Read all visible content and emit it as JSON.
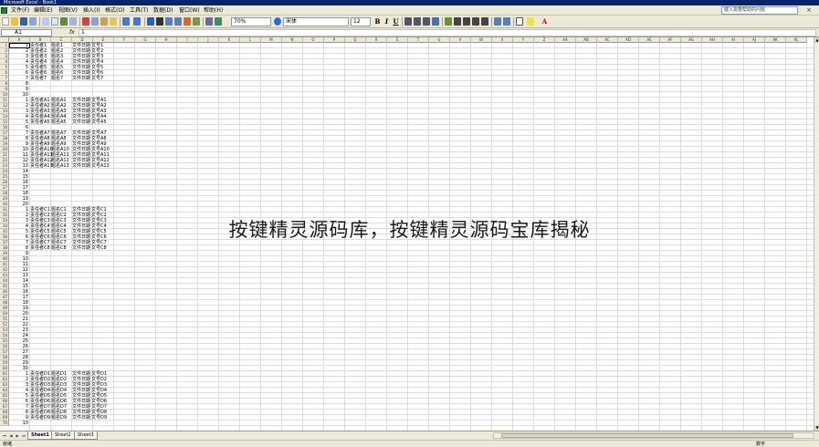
{
  "window": {
    "title": "Microsoft Excel - Book1"
  },
  "menu": {
    "items": [
      "文件(F)",
      "编辑(E)",
      "视图(V)",
      "插入(I)",
      "格式(O)",
      "工具(T)",
      "数据(D)",
      "窗口(W)",
      "帮助(H)"
    ],
    "help_placeholder": "键入需要帮助的问题",
    "close_glyph": "×"
  },
  "toolbar": {
    "zoom": "70%",
    "font_name": "宋体",
    "font_size": "12",
    "bold": "B",
    "italic": "I",
    "underline": "U",
    "font_color_label": "A"
  },
  "formula_bar": {
    "name_box": "A1",
    "fx": "fx",
    "value": "1"
  },
  "grid": {
    "columns": [
      "A",
      "B",
      "C",
      "D",
      "E",
      "F",
      "G",
      "H",
      "I",
      "J",
      "K",
      "L",
      "M",
      "N",
      "O",
      "P",
      "Q",
      "R",
      "S",
      "T",
      "U",
      "V",
      "W",
      "X",
      "Y",
      "Z",
      "AA",
      "AB",
      "AC",
      "AD",
      "AE",
      "AF",
      "AG",
      "AH",
      "AI",
      "AJ",
      "AK",
      "AL"
    ],
    "row_labels": [
      "1",
      "2",
      "3",
      "4",
      "5",
      "6",
      "7",
      "8",
      "9",
      "10",
      "11",
      "12",
      "13",
      "14",
      "15",
      "16",
      "17",
      "18",
      "19",
      "20",
      "21",
      "22",
      "23",
      "24",
      "25",
      "26",
      "27",
      "28",
      "29",
      "30",
      "31",
      "32",
      "33",
      "34",
      "35",
      "36",
      "37",
      "38",
      "39",
      "40",
      "41",
      "42",
      "43",
      "44",
      "45",
      "46",
      "47",
      "48",
      "49",
      "50",
      "51",
      "52",
      "53",
      "54",
      "55",
      "56",
      "57",
      "58",
      "59",
      "60",
      "61",
      "62",
      "63",
      "64",
      "65",
      "66",
      "67",
      "68",
      "69",
      "70"
    ],
    "rows": [
      [
        "1",
        "责任者1",
        "题名1",
        "文件日期",
        "文号1"
      ],
      [
        "2",
        "责任者2",
        "题名2",
        "文件日期",
        "文号2"
      ],
      [
        "3",
        "责任者3",
        "题名3",
        "文件日期",
        "文号3"
      ],
      [
        "4",
        "责任者4",
        "题名4",
        "文件日期",
        "文号4"
      ],
      [
        "5",
        "责任者5",
        "题名5",
        "文件日期",
        "文号5"
      ],
      [
        "6",
        "责任者6",
        "题名6",
        "文件日期",
        "文号6"
      ],
      [
        "7",
        "责任者7",
        "题名7",
        "文件日期",
        "文号7"
      ],
      [
        "8",
        "",
        "",
        "",
        ""
      ],
      [
        "9",
        "",
        "",
        "",
        ""
      ],
      [
        "10",
        "",
        "",
        "",
        ""
      ],
      [
        "1",
        "责任者A1",
        "题名A1",
        "文件日期",
        "文号A1"
      ],
      [
        "2",
        "责任者A2",
        "题名A2",
        "文件日期",
        "文号A2"
      ],
      [
        "3",
        "责任者A3",
        "题名A3",
        "文件日期",
        "文号A3"
      ],
      [
        "4",
        "责任者A4",
        "题名A4",
        "文件日期",
        "文号A4"
      ],
      [
        "5",
        "责任者A5",
        "题名A5",
        "文件日期",
        "文号A5"
      ],
      [
        "6",
        "",
        "",
        "",
        ""
      ],
      [
        "7",
        "责任者A7",
        "题名A7",
        "文件日期",
        "文号A7"
      ],
      [
        "8",
        "责任者A8",
        "题名A8",
        "文件日期",
        "文号A8"
      ],
      [
        "9",
        "责任者A9",
        "题名A9",
        "文件日期",
        "文号A9"
      ],
      [
        "10",
        "责任者A10",
        "题名A10",
        "文件日期",
        "文号A10"
      ],
      [
        "11",
        "责任者A11",
        "题名A11",
        "文件日期",
        "文号A11"
      ],
      [
        "12",
        "责任者A12",
        "题名A12",
        "文件日期",
        "文号A12"
      ],
      [
        "13",
        "责任者A13",
        "题名A13",
        "文件日期",
        "文号A13"
      ],
      [
        "14",
        "",
        "",
        "",
        ""
      ],
      [
        "15",
        "",
        "",
        "",
        ""
      ],
      [
        "16",
        "",
        "",
        "",
        ""
      ],
      [
        "17",
        "",
        "",
        "",
        ""
      ],
      [
        "18",
        "",
        "",
        "",
        ""
      ],
      [
        "19",
        "",
        "",
        "",
        ""
      ],
      [
        "20",
        "",
        "",
        "",
        ""
      ],
      [
        "1",
        "责任者C1",
        "题名C1",
        "文件日期",
        "文号C1"
      ],
      [
        "2",
        "责任者C2",
        "题名C2",
        "文件日期",
        "文号C2"
      ],
      [
        "3",
        "责任者C3",
        "题名C3",
        "文件日期",
        "文号C3"
      ],
      [
        "4",
        "责任者C4",
        "题名C4",
        "文件日期",
        "文号C4"
      ],
      [
        "5",
        "责任者C5",
        "题名C5",
        "文件日期",
        "文号C5"
      ],
      [
        "6",
        "责任者C6",
        "题名C6",
        "文件日期",
        "文号C6"
      ],
      [
        "7",
        "责任者C7",
        "题名C7",
        "文件日期",
        "文号C7"
      ],
      [
        "8",
        "责任者C8",
        "题名C8",
        "文件日期",
        "文号C8"
      ],
      [
        "9",
        "",
        "",
        "",
        ""
      ],
      [
        "10",
        "",
        "",
        "",
        ""
      ],
      [
        "11",
        "",
        "",
        "",
        ""
      ],
      [
        "12",
        "",
        "",
        "",
        ""
      ],
      [
        "13",
        "",
        "",
        "",
        ""
      ],
      [
        "14",
        "",
        "",
        "",
        ""
      ],
      [
        "15",
        "",
        "",
        "",
        ""
      ],
      [
        "16",
        "",
        "",
        "",
        ""
      ],
      [
        "17",
        "",
        "",
        "",
        ""
      ],
      [
        "18",
        "",
        "",
        "",
        ""
      ],
      [
        "19",
        "",
        "",
        "",
        ""
      ],
      [
        "20",
        "",
        "",
        "",
        ""
      ],
      [
        "21",
        "",
        "",
        "",
        ""
      ],
      [
        "22",
        "",
        "",
        "",
        ""
      ],
      [
        "23",
        "",
        "",
        "",
        ""
      ],
      [
        "24",
        "",
        "",
        "",
        ""
      ],
      [
        "25",
        "",
        "",
        "",
        ""
      ],
      [
        "26",
        "",
        "",
        "",
        ""
      ],
      [
        "27",
        "",
        "",
        "",
        ""
      ],
      [
        "28",
        "",
        "",
        "",
        ""
      ],
      [
        "29",
        "",
        "",
        "",
        ""
      ],
      [
        "30",
        "",
        "",
        "",
        ""
      ],
      [
        "1",
        "责任者D1",
        "题名D1",
        "文件日期",
        "文号D1"
      ],
      [
        "2",
        "责任者D2",
        "题名D2",
        "文件日期",
        "文号D2"
      ],
      [
        "3",
        "责任者D3",
        "题名D3",
        "文件日期",
        "文号D3"
      ],
      [
        "4",
        "责任者D4",
        "题名D4",
        "文件日期",
        "文号D4"
      ],
      [
        "5",
        "责任者D5",
        "题名D5",
        "文件日期",
        "文号D5"
      ],
      [
        "6",
        "责任者D6",
        "题名D6",
        "文件日期",
        "文号D6"
      ],
      [
        "7",
        "责任者D7",
        "题名D7",
        "文件日期",
        "文号D7"
      ],
      [
        "8",
        "责任者D8",
        "题名D8",
        "文件日期",
        "文号D8"
      ],
      [
        "9",
        "责任者D9",
        "题名D9",
        "文件日期",
        "文号D9"
      ],
      [
        "10",
        "",
        "",
        "",
        ""
      ]
    ]
  },
  "sheets": [
    "Sheet1",
    "Sheet2",
    "Sheet3"
  ],
  "status": {
    "left": "就绪",
    "right": "数字"
  },
  "overlay_text": "按键精灵源码库，按键精灵源码宝库揭秘"
}
